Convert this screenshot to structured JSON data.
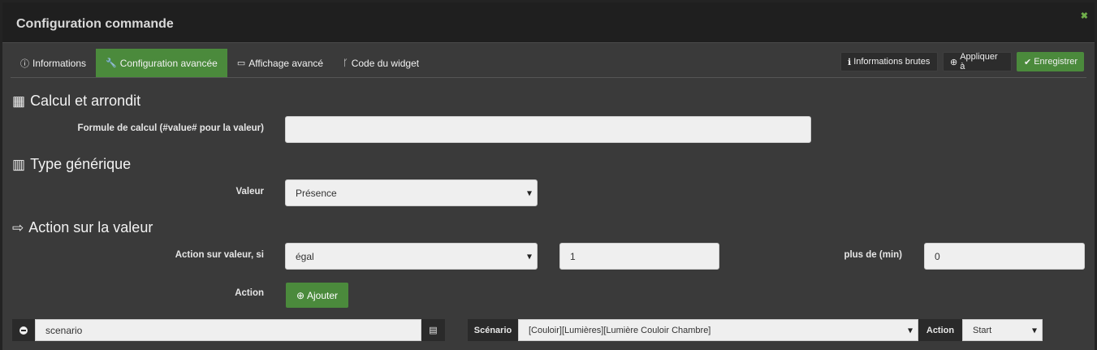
{
  "dialog": {
    "title": "Configuration commande",
    "close_icon": "close-icon",
    "accent": "#4b8a3c"
  },
  "tabs": [
    {
      "label": "Informations",
      "icon": "info-icon"
    },
    {
      "label": "Configuration avancée",
      "icon": "wrench-icon"
    },
    {
      "label": "Affichage avancé",
      "icon": "desktop-icon"
    },
    {
      "label": "Code du widget",
      "icon": "code-fork-icon"
    }
  ],
  "top_buttons": {
    "raw_info": "Informations brutes",
    "apply_to": "Appliquer à",
    "save": "Enregistrer"
  },
  "sections": {
    "calc": {
      "title": "Calcul et arrondit",
      "formula_label": "Formule de calcul (#value# pour la valeur)",
      "formula_value": ""
    },
    "generic": {
      "title": "Type générique",
      "value_label": "Valeur",
      "value_selected": "Présence"
    },
    "action": {
      "title": "Action sur la valeur",
      "condition_label": "Action sur valeur, si",
      "operator_selected": "égal",
      "compare_value": "1",
      "duration_label": "plus de (min)",
      "duration_value": "0",
      "action_label": "Action",
      "add_label": "Ajouter"
    }
  },
  "action_row": {
    "command_value": "scenario",
    "scenario_label": "Scénario",
    "scenario_selected": "[Couloir][Lumières][Lumière Couloir Chambre]",
    "action_label": "Action",
    "action_selected": "Start"
  }
}
